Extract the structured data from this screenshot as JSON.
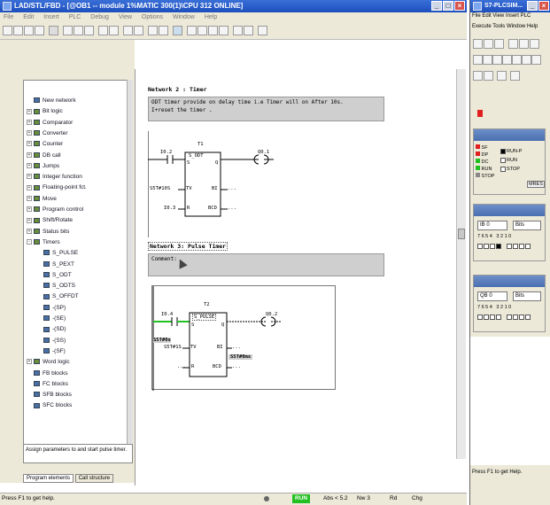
{
  "main_window": {
    "title": "LAD/STL/FBD - [@OB1 -- module 1%MATIC 300(1)\\CPU 312 ONLINE]",
    "menu": [
      "File",
      "Edit",
      "Insert",
      "PLC",
      "Debug",
      "View",
      "Options",
      "Window",
      "Help"
    ]
  },
  "tree": {
    "items": [
      {
        "label": "New network",
        "expander": "",
        "icon": "network-icon"
      },
      {
        "label": "Bit logic",
        "expander": "+",
        "icon": "folder-icon"
      },
      {
        "label": "Comparator",
        "expander": "+",
        "icon": "folder-icon"
      },
      {
        "label": "Converter",
        "expander": "+",
        "icon": "folder-icon"
      },
      {
        "label": "Counter",
        "expander": "+",
        "icon": "folder-icon"
      },
      {
        "label": "DB call",
        "expander": "+",
        "icon": "folder-icon"
      },
      {
        "label": "Jumps",
        "expander": "+",
        "icon": "folder-icon"
      },
      {
        "label": "Integer function",
        "expander": "+",
        "icon": "folder-icon"
      },
      {
        "label": "Floating-point fct.",
        "expander": "+",
        "icon": "folder-icon"
      },
      {
        "label": "Move",
        "expander": "+",
        "icon": "folder-icon"
      },
      {
        "label": "Program control",
        "expander": "+",
        "icon": "folder-icon"
      },
      {
        "label": "Shift/Rotate",
        "expander": "+",
        "icon": "folder-icon"
      },
      {
        "label": "Status bits",
        "expander": "+",
        "icon": "folder-icon"
      },
      {
        "label": "Timers",
        "expander": "-",
        "icon": "folder-icon"
      },
      {
        "label": "S_PULSE",
        "expander": "",
        "icon": "block-icon",
        "indent": 1
      },
      {
        "label": "S_PEXT",
        "expander": "",
        "icon": "block-icon",
        "indent": 1
      },
      {
        "label": "S_ODT",
        "expander": "",
        "icon": "block-icon",
        "indent": 1
      },
      {
        "label": "S_ODTS",
        "expander": "",
        "icon": "block-icon",
        "indent": 1
      },
      {
        "label": "S_OFFDT",
        "expander": "",
        "icon": "block-icon",
        "indent": 1
      },
      {
        "label": "-(SP)",
        "expander": "",
        "icon": "coil-icon",
        "indent": 1
      },
      {
        "label": "-(SE)",
        "expander": "",
        "icon": "coil-icon",
        "indent": 1
      },
      {
        "label": "-(SD)",
        "expander": "",
        "icon": "coil-icon",
        "indent": 1
      },
      {
        "label": "-(SS)",
        "expander": "",
        "icon": "coil-icon",
        "indent": 1
      },
      {
        "label": "-(SF)",
        "expander": "",
        "icon": "coil-icon",
        "indent": 1
      },
      {
        "label": "Word logic",
        "expander": "+",
        "icon": "folder-icon"
      },
      {
        "label": "FB blocks",
        "expander": "",
        "icon": "block-icon"
      },
      {
        "label": "FC blocks",
        "expander": "",
        "icon": "block-icon"
      },
      {
        "label": "SFB blocks",
        "expander": "",
        "icon": "block-icon"
      },
      {
        "label": "SFC blocks",
        "expander": "",
        "icon": "block-icon"
      }
    ],
    "hint": "Assign parameters to and start pulse timer.",
    "tabs": [
      "Program elements",
      "Call structure"
    ]
  },
  "network2": {
    "title": "Network 2 : Timer",
    "comment_line1": "ODT timer provide on delay time i.e Timer will on After 10s.",
    "comment_line2": "I+reset the timer .",
    "timer": "T1",
    "block": "S_ODT",
    "input": "I0.2",
    "output": "Q0.1",
    "pin_s": "S",
    "pin_q": "Q",
    "pin_tv": "TV",
    "pin_bi": "BI",
    "pin_r": "R",
    "pin_bcd": "BCD",
    "tv_value": "S5T#10S",
    "reset": "I0.3",
    "ellipsis": "..."
  },
  "network3": {
    "title": "Network 3: Pulse Timer",
    "comment_label": "Comment:",
    "timer": "T2",
    "block": "S_PULSE",
    "input": "I0.4",
    "output": "Q0.2",
    "pin_s": "S",
    "pin_q": "Q",
    "pin_tv": "TV",
    "pin_bi": "BI",
    "pin_r": "R",
    "pin_bcd": "BCD",
    "tv_prefix": "S5T#0s",
    "tv_value": "S5T#1S",
    "bi_value": "S5T#0ms",
    "ellipsis": "..."
  },
  "status_bar": {
    "help": "Press F1 to get help.",
    "run": "RUN",
    "abs": "Abs < 5.2",
    "nw": "Nw 3",
    "rd": "Rd",
    "chg": "Chg"
  },
  "right_window": {
    "title": "S7-PLCSIM...",
    "menu_row1": [
      "File",
      "Edit",
      "View",
      "Insert",
      "PLC"
    ],
    "menu_row2": [
      "Execute",
      "Tools",
      "Window",
      "Help"
    ],
    "cpu": {
      "leds": [
        "SF",
        "DP",
        "DC",
        "RUN",
        "STOP"
      ],
      "modes": [
        "RUN-P",
        "RUN",
        "STOP"
      ],
      "mres": "MRES"
    },
    "input_byte": {
      "address": "IB 0",
      "format": "Bits",
      "bits": "7 6 5 4   3 2 1 0"
    },
    "output_byte": {
      "address": "QB 0",
      "format": "Bits",
      "bits": "7 6 5 4   3 2 1 0"
    },
    "help": "Press F1 to get Help."
  },
  "colors": {
    "titlebar": "#1c4fbd",
    "chrome": "#ece9d8",
    "comment_bg": "#cfcfcf",
    "run_green": "#22c022",
    "led_red": "#e02020"
  }
}
